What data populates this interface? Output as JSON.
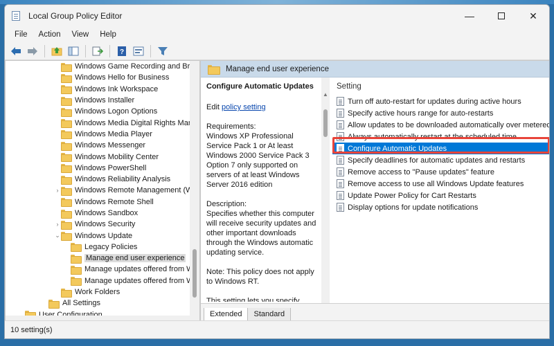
{
  "window": {
    "title": "Local Group Policy Editor",
    "minimize": "—",
    "close": "✕"
  },
  "menu": [
    "File",
    "Action",
    "View",
    "Help"
  ],
  "toolbar_icons": [
    "back-arrow-icon",
    "forward-arrow-icon",
    "up-folder-icon",
    "show-hide-tree-icon",
    "export-list-icon",
    "help-icon",
    "properties-icon",
    "filter-icon"
  ],
  "tree": {
    "items": [
      {
        "label": "Windows Game Recording and Broa",
        "indent": 1
      },
      {
        "label": "Windows Hello for Business",
        "indent": 1
      },
      {
        "label": "Windows Ink Workspace",
        "indent": 1
      },
      {
        "label": "Windows Installer",
        "indent": 1
      },
      {
        "label": "Windows Logon Options",
        "indent": 1
      },
      {
        "label": "Windows Media Digital Rights Man",
        "indent": 1
      },
      {
        "label": "Windows Media Player",
        "indent": 1
      },
      {
        "label": "Windows Messenger",
        "indent": 1
      },
      {
        "label": "Windows Mobility Center",
        "indent": 1
      },
      {
        "label": "Windows PowerShell",
        "indent": 1
      },
      {
        "label": "Windows Reliability Analysis",
        "indent": 1
      },
      {
        "label": "Windows Remote Management (Wi",
        "indent": 1,
        "chevron": "›"
      },
      {
        "label": "Windows Remote Shell",
        "indent": 1
      },
      {
        "label": "Windows Sandbox",
        "indent": 1
      },
      {
        "label": "Windows Security",
        "indent": 1,
        "chevron": "›"
      },
      {
        "label": "Windows Update",
        "indent": 1,
        "chevron": "⌄"
      },
      {
        "label": "Legacy Policies",
        "indent": 2
      },
      {
        "label": "Manage end user experience",
        "indent": 2,
        "selected": true
      },
      {
        "label": "Manage updates offered from W",
        "indent": 2
      },
      {
        "label": "Manage updates offered from W",
        "indent": 2
      },
      {
        "label": "Work Folders",
        "indent": 1
      },
      {
        "label": "All Settings",
        "indent": 0
      },
      {
        "label": "User Configuration",
        "indent": -1
      }
    ]
  },
  "right": {
    "header": "Manage end user experience",
    "description": {
      "title": "Configure Automatic Updates",
      "edit_prefix": "Edit ",
      "edit_link": "policy setting",
      "requirements": "Requirements:\nWindows XP Professional Service Pack 1 or At least Windows 2000 Service Pack 3 Option 7 only supported on servers of at least Windows Server 2016 edition",
      "description": "Description:\nSpecifies whether this computer will receive security updates and other important downloads through the Windows automatic updating service.",
      "note": "Note: This policy does not apply to Windows RT.",
      "more": "This setting lets you specify whether automatic updates are enabled on this computer. If the service is enabled, you must select"
    },
    "column_header": "Setting",
    "settings": [
      "Turn off auto-restart for updates during active hours",
      "Specify active hours range for auto-restarts",
      "Allow updates to be downloaded automatically over metered...",
      "Always automatically restart at the scheduled time",
      "Configure Automatic Updates",
      "Specify deadlines for automatic updates and restarts",
      "Remove access to \"Pause updates\" feature",
      "Remove access to use all Windows Update features",
      "Update Power Policy for Cart Restarts",
      "Display options for update notifications"
    ],
    "selected_index": 4,
    "tabs": [
      "Extended",
      "Standard"
    ]
  },
  "status": "10 setting(s)",
  "colors": {
    "selection": "#0078d7",
    "highlight_box": "#e8443a",
    "header_band": "#c9daea"
  }
}
